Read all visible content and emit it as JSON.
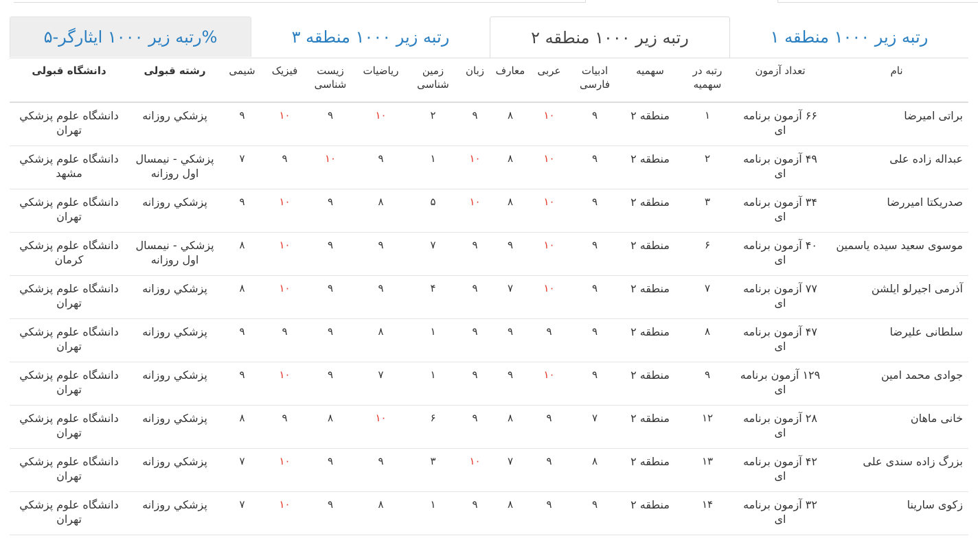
{
  "tabs": [
    {
      "label": "رتبه زیر ۱۰۰۰ منطقه ۱"
    },
    {
      "label": "رتبه زیر ۱۰۰۰ منطقه ۲"
    },
    {
      "label": "رتبه زیر ۱۰۰۰ منطقه ۳"
    },
    {
      "label": "رتبه زیر ۱۰۰۰ ایثارگر-۵%"
    }
  ],
  "active_tab": 1,
  "headers": [
    "نام",
    "تعداد آزمون",
    "رتبه در سهمیه",
    "سهمیه",
    "ادبیات فارسی",
    "عربی",
    "معارف",
    "زبان",
    "زمین شناسی",
    "ریاضیات",
    "زیست شناسی",
    "فیزیک",
    "شیمی",
    "رشته قبولی",
    "دانشگاه قبولی"
  ],
  "highlight_value": "۱۰",
  "colors": {
    "tab_blue": "#2a7fc1",
    "highlight_red": "#e5352a"
  },
  "rows": [
    [
      "براتی امیرضا",
      "۶۶ آزمون برنامه ای",
      "۱",
      "منطقه ۲",
      "۹",
      "۱۰",
      "۸",
      "۹",
      "۲",
      "۱۰",
      "۹",
      "۱۰",
      "۹",
      "پزشكي روزانه",
      "دانشگاه علوم پزشكي تهران"
    ],
    [
      "عبداله زاده علی",
      "۴۹ آزمون برنامه ای",
      "۲",
      "منطقه ۲",
      "۹",
      "۱۰",
      "۸",
      "۱۰",
      "۱",
      "۹",
      "۱۰",
      "۹",
      "۷",
      "پزشكي - نيمسال اول روزانه",
      "دانشگاه علوم پزشكي مشهد"
    ],
    [
      "صدریکتا امیررضا",
      "۳۴ آزمون برنامه ای",
      "۳",
      "منطقه ۲",
      "۹",
      "۱۰",
      "۸",
      "۱۰",
      "۵",
      "۸",
      "۹",
      "۱۰",
      "۹",
      "پزشكي روزانه",
      "دانشگاه علوم پزشكي تهران"
    ],
    [
      "موسوی سعید سیده یاسمین",
      "۴۰ آزمون برنامه ای",
      "۶",
      "منطقه ۲",
      "۹",
      "۱۰",
      "۹",
      "۹",
      "۷",
      "۹",
      "۹",
      "۱۰",
      "۸",
      "پزشكي - نيمسال اول روزانه",
      "دانشگاه علوم پزشكي كرمان"
    ],
    [
      "آذرمی اجیرلو ایلشن",
      "۷۷ آزمون برنامه ای",
      "۷",
      "منطقه ۲",
      "۹",
      "۱۰",
      "۷",
      "۹",
      "۴",
      "۹",
      "۹",
      "۱۰",
      "۸",
      "پزشكي روزانه",
      "دانشگاه علوم پزشكي تهران"
    ],
    [
      "سلطانی علیرضا",
      "۴۷ آزمون برنامه ای",
      "۸",
      "منطقه ۲",
      "۹",
      "۹",
      "۹",
      "۹",
      "۱",
      "۸",
      "۹",
      "۹",
      "۹",
      "پزشكي روزانه",
      "دانشگاه علوم پزشكي تهران"
    ],
    [
      "جوادی محمد امین",
      "۱۲۹ آزمون برنامه ای",
      "۹",
      "منطقه ۲",
      "۹",
      "۱۰",
      "۹",
      "۹",
      "۱",
      "۷",
      "۹",
      "۱۰",
      "۹",
      "پزشكي روزانه",
      "دانشگاه علوم پزشكي تهران"
    ],
    [
      "خانی ماهان",
      "۲۸ آزمون برنامه ای",
      "۱۲",
      "منطقه ۲",
      "۷",
      "۹",
      "۸",
      "۹",
      "۶",
      "۱۰",
      "۸",
      "۹",
      "۸",
      "پزشكي روزانه",
      "دانشگاه علوم پزشكي تهران"
    ],
    [
      "بزرگ زاده سندی علی",
      "۴۲ آزمون برنامه ای",
      "۱۳",
      "منطقه ۲",
      "۸",
      "۹",
      "۷",
      "۱۰",
      "۳",
      "۹",
      "۹",
      "۱۰",
      "۷",
      "پزشكي روزانه",
      "دانشگاه علوم پزشكي تهران"
    ],
    [
      "زکوی سارینا",
      "۳۲ آزمون برنامه ای",
      "۱۴",
      "منطقه ۲",
      "۹",
      "۹",
      "۸",
      "۹",
      "۱",
      "۸",
      "۹",
      "۱۰",
      "۷",
      "پزشكي روزانه",
      "دانشگاه علوم پزشكي تهران"
    ]
  ]
}
